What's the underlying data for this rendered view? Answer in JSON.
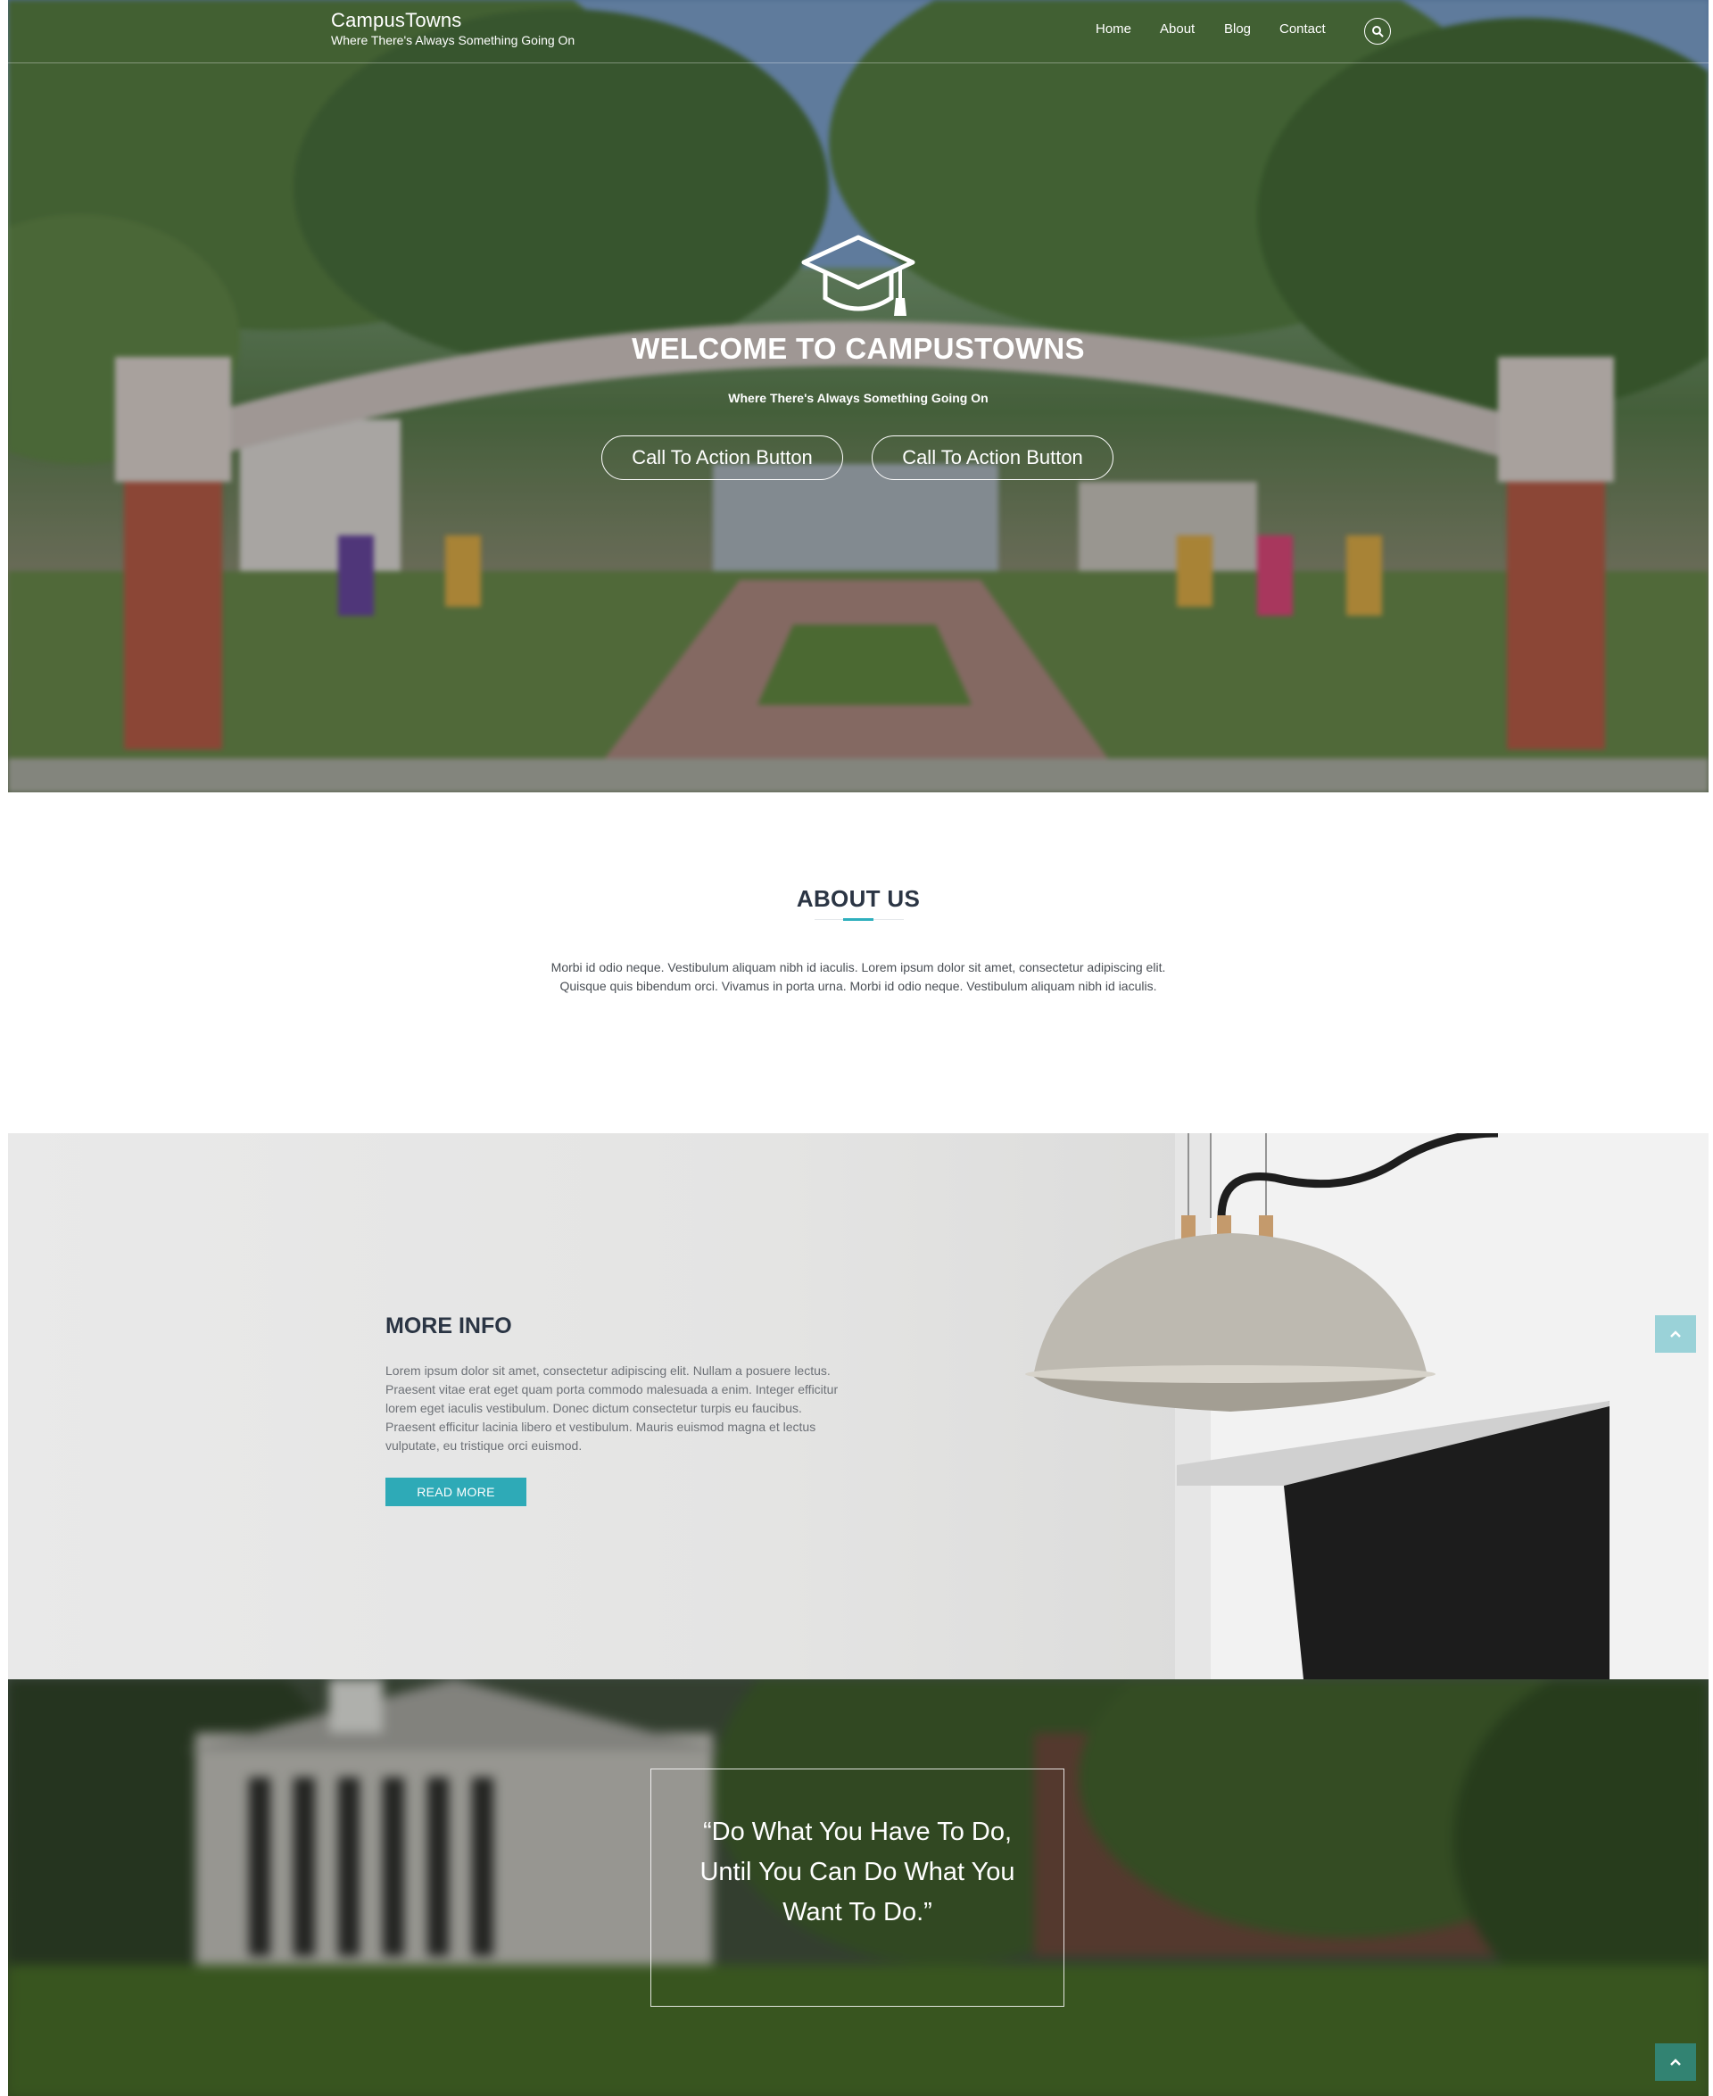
{
  "header": {
    "brand": "CampusTowns",
    "tagline": "Where There's Always Something Going On",
    "nav": [
      "Home",
      "About",
      "Blog",
      "Contact"
    ],
    "search_icon": "search-icon"
  },
  "hero": {
    "icon": "graduation-cap-icon",
    "title": "WELCOME TO CAMPUSTOWNS",
    "subtitle": "Where There's Always Something Going On",
    "cta_primary": "Call To Action Button",
    "cta_secondary": "Call To Action Button"
  },
  "about": {
    "heading": "ABOUT US",
    "body": "Morbi id odio neque. Vestibulum aliquam nibh id iaculis. Lorem ipsum dolor sit amet, consectetur adipiscing elit. Quisque quis bibendum orci. Vivamus in porta urna. Morbi id odio neque. Vestibulum aliquam nibh id iaculis."
  },
  "more_info": {
    "heading": "MORE INFO",
    "body": "Lorem ipsum dolor sit amet, consectetur adipiscing elit. Nullam a posuere lectus. Praesent vitae erat eget quam porta commodo malesuada a enim. Integer efficitur lorem eget iaculis vestibulum. Donec dictum consectetur turpis eu faucibus. Praesent efficitur lacinia libero et vestibulum. Mauris euismod magna et lectus vulputate, eu tristique orci euismod.",
    "button": "READ MORE"
  },
  "quote": {
    "text": "“Do What You Have To Do, Until You Can Do What You Want To Do.”"
  },
  "back_to_top_icon": "chevron-up-icon",
  "colors": {
    "accent": "#2eaab7",
    "heading": "#2b3544",
    "body_text": "#4a4f55"
  }
}
